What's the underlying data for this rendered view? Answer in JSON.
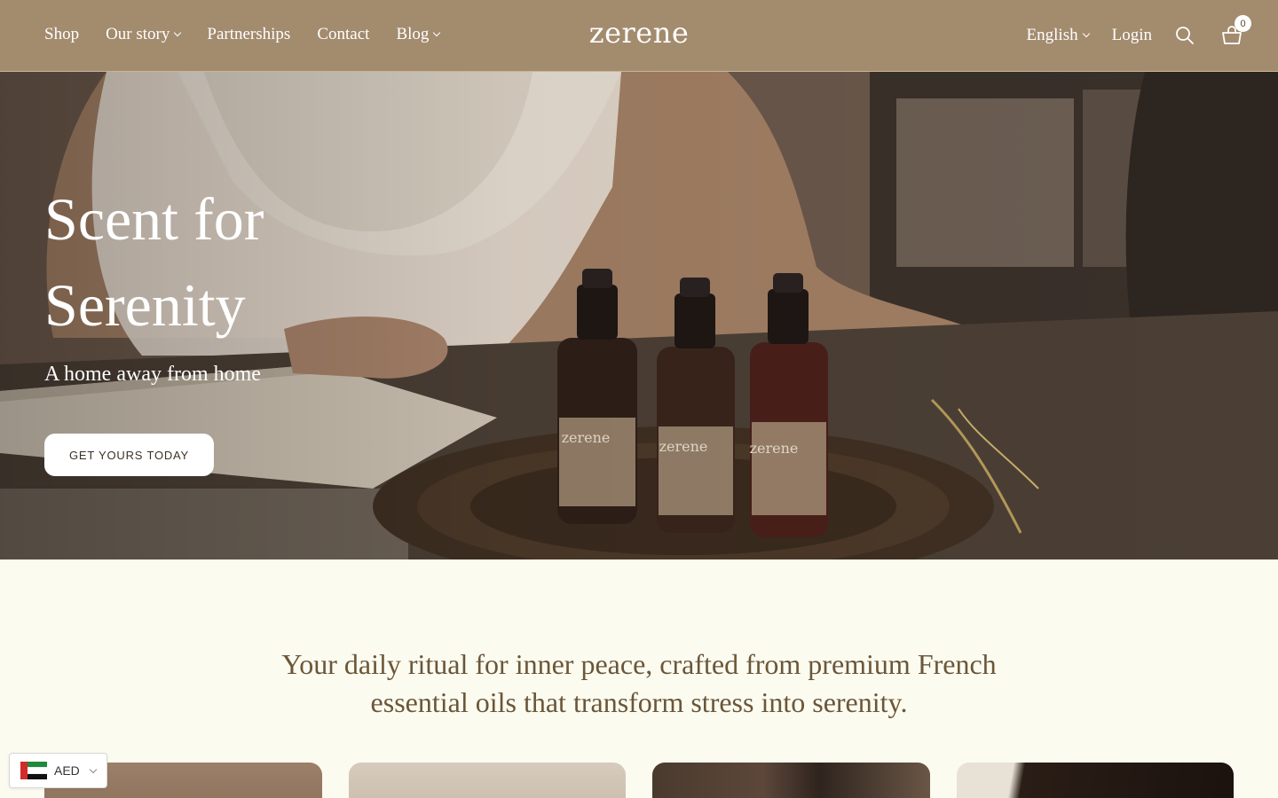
{
  "header": {
    "logo": "zerene",
    "nav": [
      {
        "label": "Shop",
        "has_dropdown": false
      },
      {
        "label": "Our story",
        "has_dropdown": true
      },
      {
        "label": "Partnerships",
        "has_dropdown": false
      },
      {
        "label": "Contact",
        "has_dropdown": false
      },
      {
        "label": "Blog",
        "has_dropdown": true
      }
    ],
    "language": "English",
    "login": "Login",
    "cart_count": "0",
    "icons": [
      "search-icon",
      "cart-icon"
    ],
    "bg_color": "#a38b6e"
  },
  "hero": {
    "title_line1": "Scent for",
    "title_line2": "Serenity",
    "subtitle": "A home away from home",
    "cta": "GET YOURS TODAY",
    "bottle_labels": [
      "zerene",
      "zerene",
      "zerene"
    ]
  },
  "tagline": {
    "line1": "Your daily ritual for inner peace, crafted from premium French",
    "line2": "essential oils that transform stress into serenity."
  },
  "currency": {
    "code": "AED",
    "flag": "uae-flag-icon"
  },
  "colors": {
    "page_bg": "#fbfbf0",
    "text_brown": "#6b5638"
  }
}
